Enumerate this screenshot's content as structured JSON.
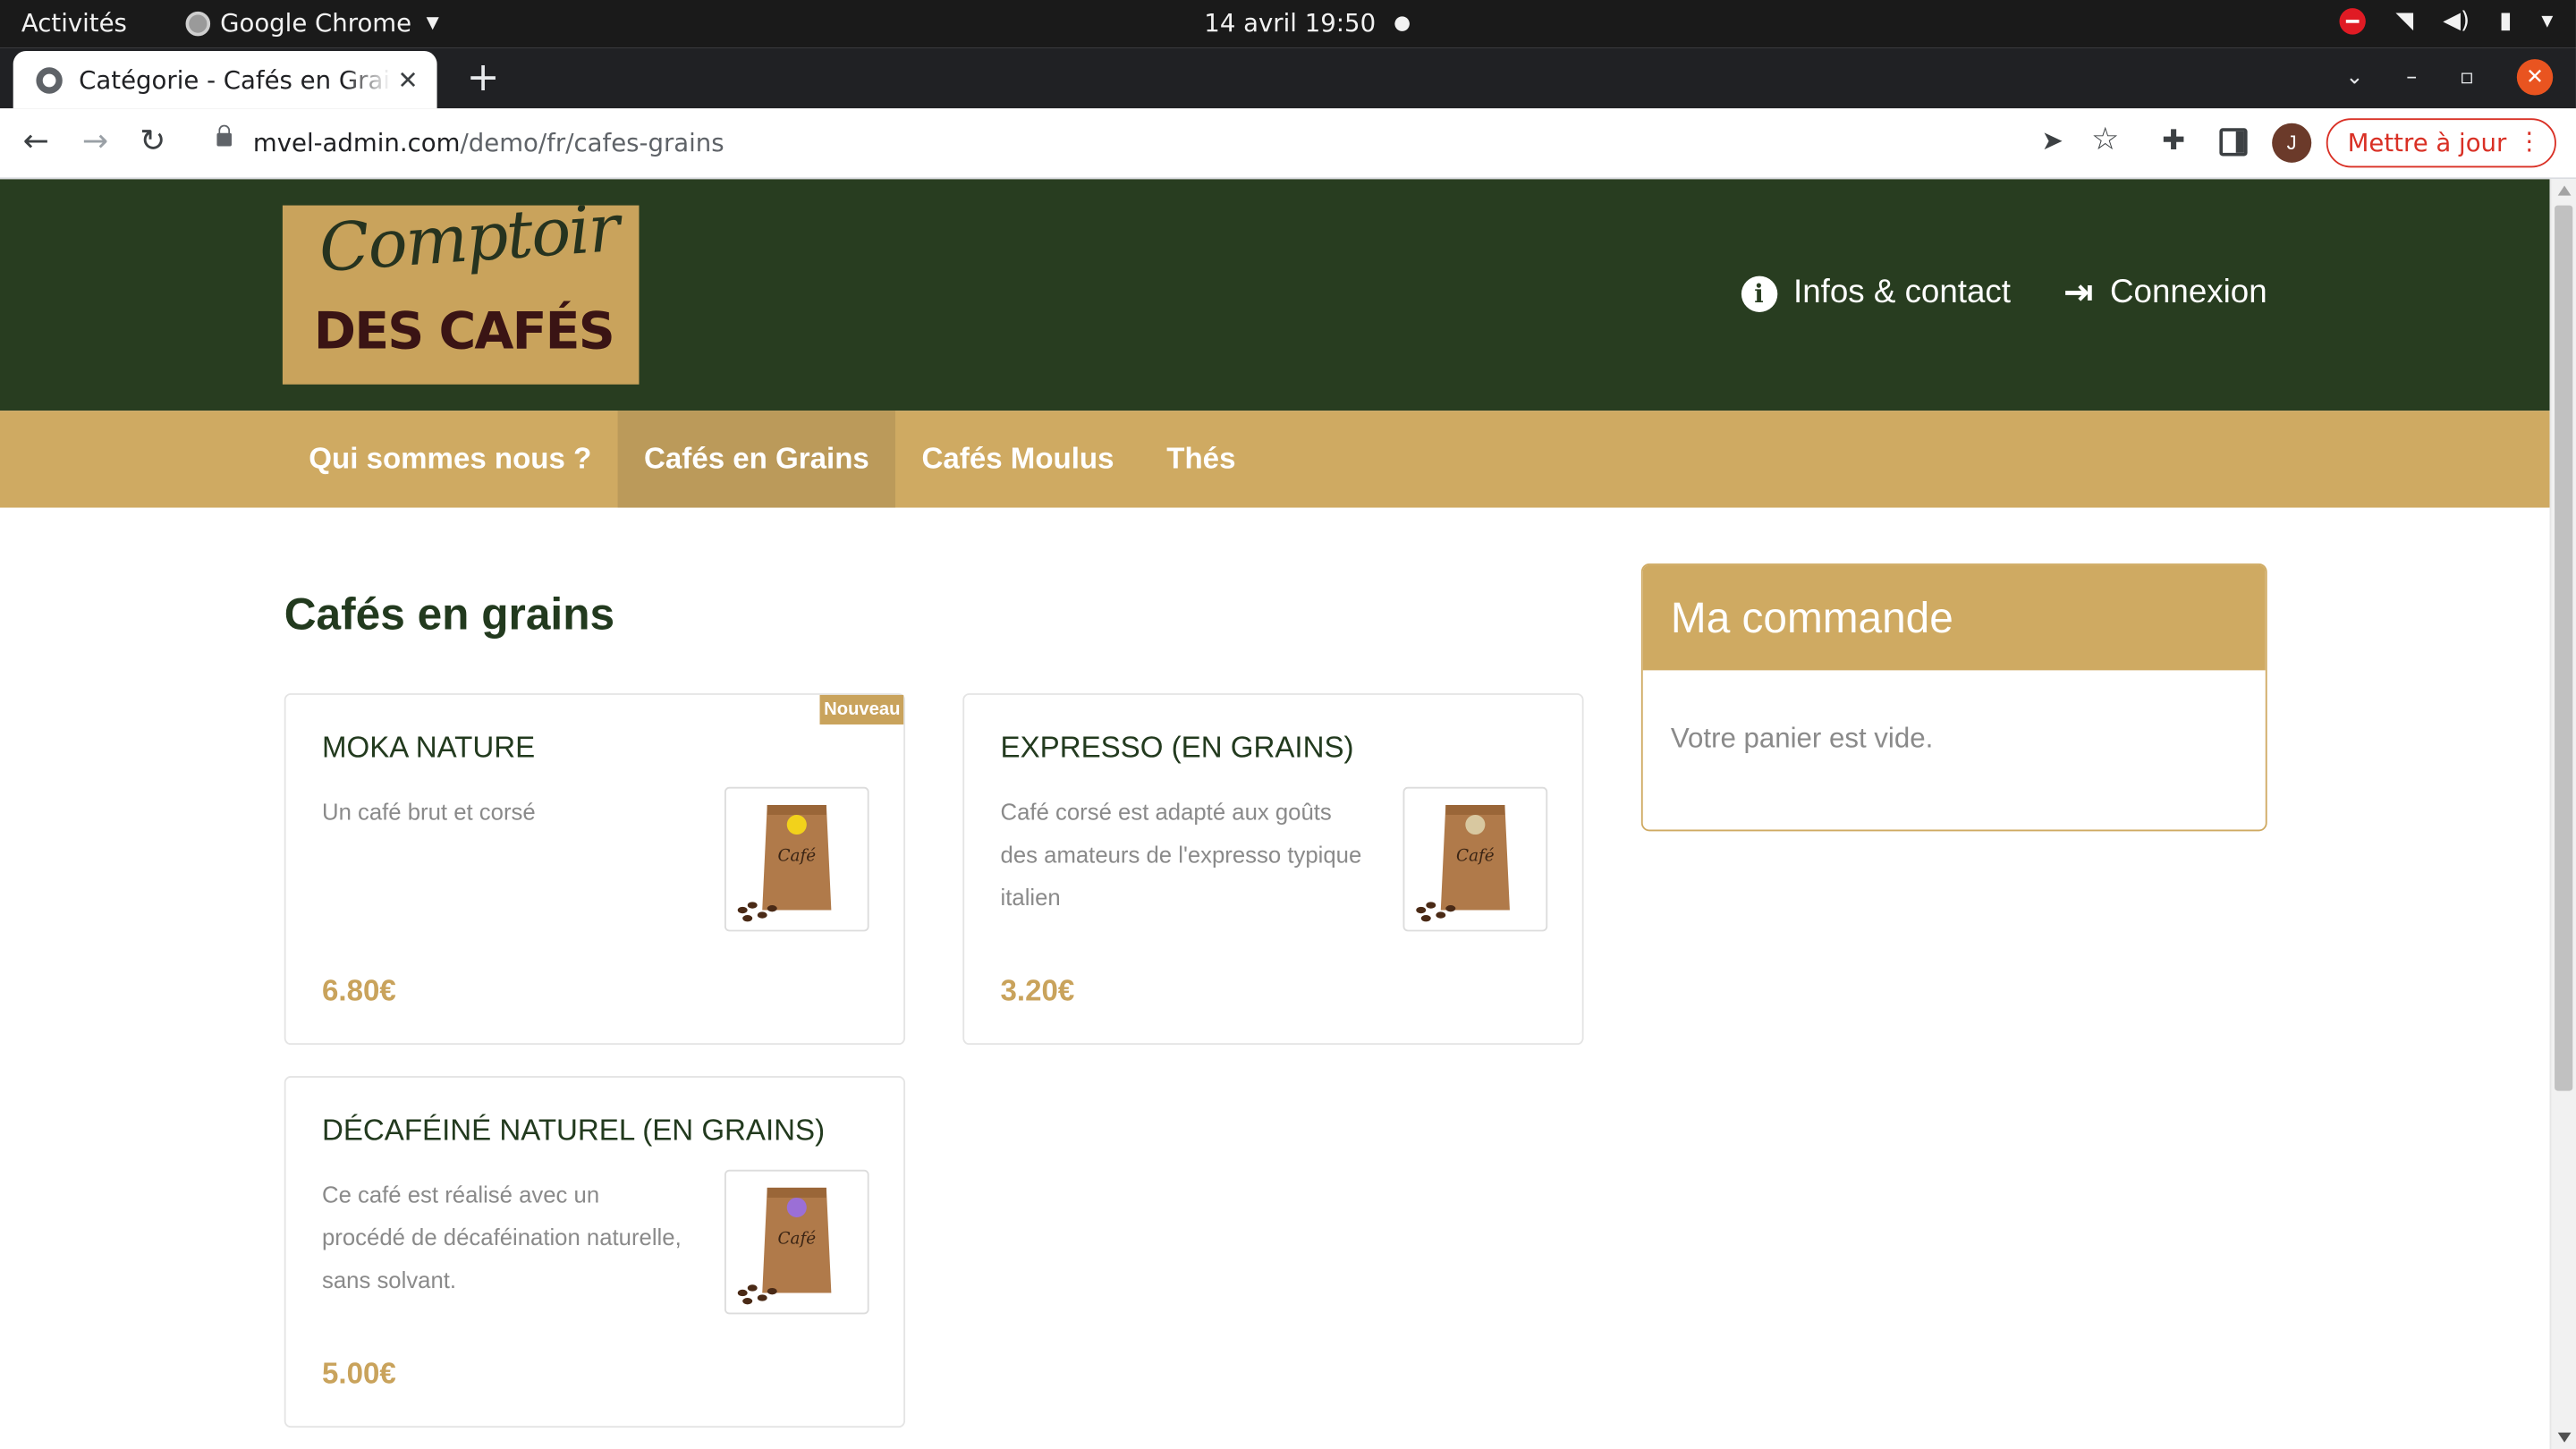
{
  "os": {
    "activities": "Activités",
    "app_name": "Google Chrome",
    "clock": "14 avril  19:50"
  },
  "browser": {
    "tab_title": "Catégorie - Cafés en Grains",
    "url_domain": "mvel-admin.com",
    "url_path": "/demo/fr/cafes-grains",
    "avatar_letter": "J",
    "update_label": "Mettre à jour"
  },
  "site": {
    "logo_script": "Comptoir",
    "logo_bold": "DES CAFÉS",
    "header_links": {
      "info": "Infos & contact",
      "login": "Connexion"
    },
    "nav": [
      {
        "label": "Qui sommes nous ?",
        "active": false
      },
      {
        "label": "Cafés en Grains",
        "active": true
      },
      {
        "label": "Cafés Moulus",
        "active": false
      },
      {
        "label": "Thés",
        "active": false
      }
    ],
    "category_title": "Cafés en grains",
    "products": [
      {
        "name": "MOKA NATURE",
        "description": "Un café brut et corsé",
        "price": "6.80€",
        "badge": "Nouveau",
        "label_color": "#f2d21b",
        "bag_text": "Café"
      },
      {
        "name": "EXPRESSO (EN GRAINS)",
        "description": "Café corsé est adapté aux goûts des amateurs de l'expresso typique italien",
        "price": "3.20€",
        "badge": "",
        "label_color": "#d8c8a0",
        "bag_text": "Café"
      },
      {
        "name": "DÉCAFÉINÉ NATUREL (EN GRAINS)",
        "description": "Ce café est réalisé avec un procédé de décaféination naturelle, sans solvant.",
        "price": "5.00€",
        "badge": "",
        "label_color": "#9b6fd6",
        "bag_text": "Café"
      }
    ],
    "order": {
      "title": "Ma commande",
      "empty_text": "Votre panier est vide."
    }
  },
  "colors": {
    "header_green": "#283d20",
    "nav_gold": "#cfaa62",
    "nav_active": "#bb9a5a",
    "price_gold": "#c9a35c"
  }
}
